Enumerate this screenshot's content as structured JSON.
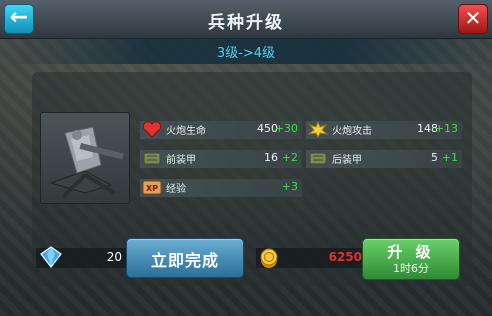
{
  "header": {
    "title": "兵种升级",
    "level_change": "3级->4级",
    "back_icon": "arrow-left-icon",
    "close_icon": "close-icon"
  },
  "stats": [
    {
      "icon": "heart-icon",
      "label": "火炮生命",
      "value": "450",
      "increase": "+30"
    },
    {
      "icon": "explosion-icon",
      "label": "火炮攻击",
      "value": "148",
      "increase": "+13"
    },
    {
      "icon": "armor-plate-icon",
      "label": "前装甲",
      "value": "16",
      "increase": "+2"
    },
    {
      "icon": "armor-plate-icon",
      "label": "后装甲",
      "value": "5",
      "increase": "+1"
    },
    {
      "icon": "xp-badge-icon",
      "label": "经验",
      "value": "",
      "increase": "+3"
    }
  ],
  "footer": {
    "gem_icon": "gem-icon",
    "gem_cost": "20",
    "complete_label": "立即完成",
    "gold_icon": "gold-coin-icon",
    "gold_cost": "6250",
    "upgrade_label": "升 级",
    "upgrade_time": "1时6分"
  },
  "colors": {
    "accent_cyan": "#4fd3f3",
    "increase_green": "#39e04a",
    "gold_cost_red": "#e1312c"
  }
}
